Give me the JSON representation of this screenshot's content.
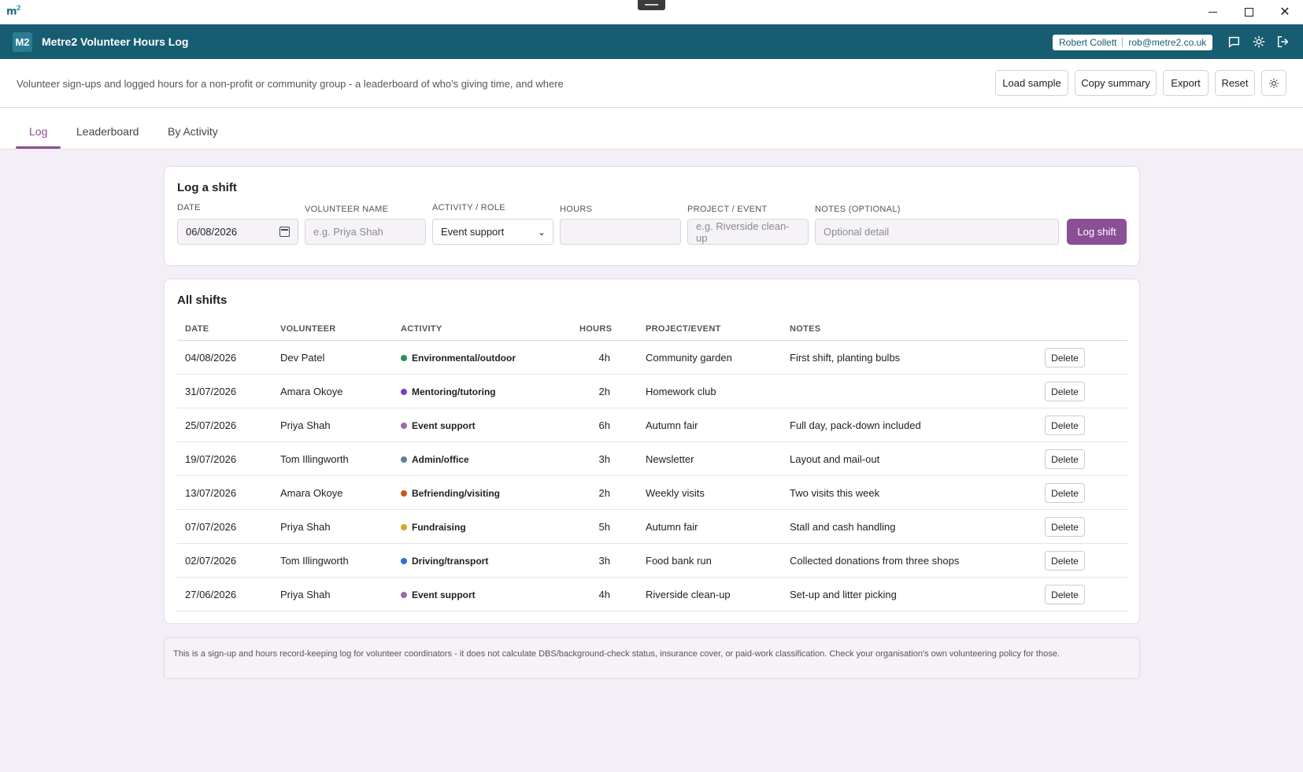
{
  "os": {
    "logo": "m",
    "logo_sup": "2"
  },
  "app": {
    "badge": "M2",
    "title": "Metre2 Volunteer Hours Log",
    "user_name": "Robert Collett",
    "user_email": "rob@metre2.co.uk"
  },
  "toolbar": {
    "subtitle": "Volunteer sign-ups and logged hours for a non-profit or community group - a leaderboard of who's giving time, and where",
    "load_sample": "Load sample",
    "copy_summary": "Copy summary",
    "export": "Export",
    "reset": "Reset"
  },
  "tabs": [
    {
      "label": "Log",
      "active": true
    },
    {
      "label": "Leaderboard",
      "active": false
    },
    {
      "label": "By Activity",
      "active": false
    }
  ],
  "form": {
    "title": "Log a shift",
    "date_label": "DATE",
    "date_value": "06/08/2026",
    "name_label": "VOLUNTEER NAME",
    "name_placeholder": "e.g. Priya Shah",
    "activity_label": "ACTIVITY / ROLE",
    "activity_value": "Event support",
    "hours_label": "HOURS",
    "hours_value": "",
    "project_label": "PROJECT / EVENT",
    "project_placeholder": "e.g. Riverside clean-up",
    "notes_label": "NOTES (OPTIONAL)",
    "notes_placeholder": "Optional detail",
    "submit": "Log shift"
  },
  "shifts": {
    "title": "All shifts",
    "headers": [
      "DATE",
      "VOLUNTEER",
      "ACTIVITY",
      "HOURS",
      "PROJECT/EVENT",
      "NOTES"
    ],
    "delete_label": "Delete",
    "rows": [
      {
        "date": "04/08/2026",
        "volunteer": "Dev Patel",
        "activity": "Environmental/outdoor",
        "color": "#2e8b57",
        "hours": "4h",
        "project": "Community garden",
        "notes": "First shift, planting bulbs"
      },
      {
        "date": "31/07/2026",
        "volunteer": "Amara Okoye",
        "activity": "Mentoring/tutoring",
        "color": "#7b3fc4",
        "hours": "2h",
        "project": "Homework club",
        "notes": ""
      },
      {
        "date": "25/07/2026",
        "volunteer": "Priya Shah",
        "activity": "Event support",
        "color": "#9a6aa8",
        "hours": "6h",
        "project": "Autumn fair",
        "notes": "Full day, pack-down included"
      },
      {
        "date": "19/07/2026",
        "volunteer": "Tom Illingworth",
        "activity": "Admin/office",
        "color": "#5b7f9a",
        "hours": "3h",
        "project": "Newsletter",
        "notes": "Layout and mail-out"
      },
      {
        "date": "13/07/2026",
        "volunteer": "Amara Okoye",
        "activity": "Befriending/visiting",
        "color": "#c9541e",
        "hours": "2h",
        "project": "Weekly visits",
        "notes": "Two visits this week"
      },
      {
        "date": "07/07/2026",
        "volunteer": "Priya Shah",
        "activity": "Fundraising",
        "color": "#d4a62a",
        "hours": "5h",
        "project": "Autumn fair",
        "notes": "Stall and cash handling"
      },
      {
        "date": "02/07/2026",
        "volunteer": "Tom Illingworth",
        "activity": "Driving/transport",
        "color": "#2f6fd6",
        "hours": "3h",
        "project": "Food bank run",
        "notes": "Collected donations from three shops"
      },
      {
        "date": "27/06/2026",
        "volunteer": "Priya Shah",
        "activity": "Event support",
        "color": "#9a6aa8",
        "hours": "4h",
        "project": "Riverside clean-up",
        "notes": "Set-up and litter picking"
      }
    ]
  },
  "disclaimer": "This is a sign-up and hours record-keeping log for volunteer coordinators - it does not calculate DBS/background-check status, insurance cover, or paid-work classification. Check your organisation's own volunteering policy for those.",
  "icons": {
    "window_minimize": "minimize-icon",
    "window_maximize": "maximize-icon",
    "window_close": "close-icon",
    "chat": "chat-icon",
    "settings": "gear-icon",
    "logout": "logout-icon",
    "theme": "sun-icon",
    "calendar": "calendar-icon",
    "chevron": "chevron-down-icon"
  },
  "colors": {
    "brand": "#175d72",
    "accent": "#8a4f95"
  }
}
